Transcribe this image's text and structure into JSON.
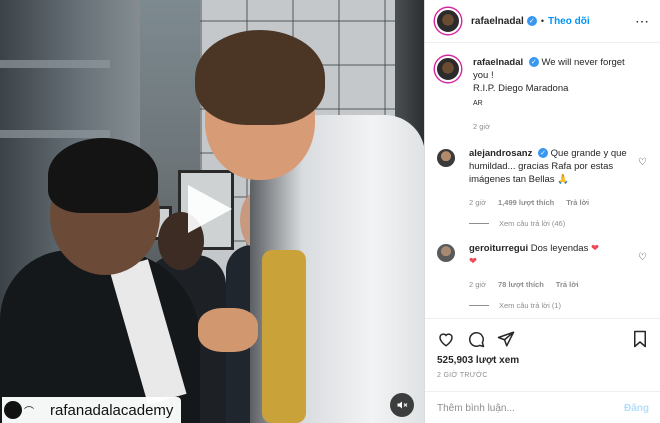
{
  "header": {
    "username": "rafaelnadal",
    "separator": "•",
    "follow_label": "Theo dõi",
    "more_icon": "⋯"
  },
  "caption": {
    "username": "rafaelnadal",
    "text": "We will never forget you !",
    "line2": "R.I.P. Diego Maradona",
    "tag": "AR",
    "time": "2 giờ"
  },
  "comments": [
    {
      "username": "alejandrosanz",
      "text": "Que grande y que humildad... gracias Rafa por estas imágenes tan Bellas 🙏",
      "time": "2 giờ",
      "likes": "1,499 lượt thích",
      "reply": "Trả lời",
      "view_replies": "Xem câu trả lời (46)"
    },
    {
      "username": "geroiturregui",
      "text": "Dos leyendas",
      "hearts": "❤",
      "time": "2 giờ",
      "likes": "78 lượt thích",
      "reply": "Trả lời",
      "view_replies": "Xem câu trả lời (1)"
    }
  ],
  "stats": {
    "views": "525,903 lượt xem",
    "posted_ago": "2 GIỜ TRƯỚC"
  },
  "composer": {
    "placeholder": "Thêm bình luận...",
    "post_label": "Đăng"
  },
  "video": {
    "watermark": "rafanadalacademy",
    "play_icon": "play-icon",
    "mute_icon": "muted-speaker-icon"
  },
  "colors": {
    "verified": "#3897f0",
    "follow": "#0095f6",
    "post_disabled": "#b2dffc",
    "heart_red": "#ed4956"
  }
}
